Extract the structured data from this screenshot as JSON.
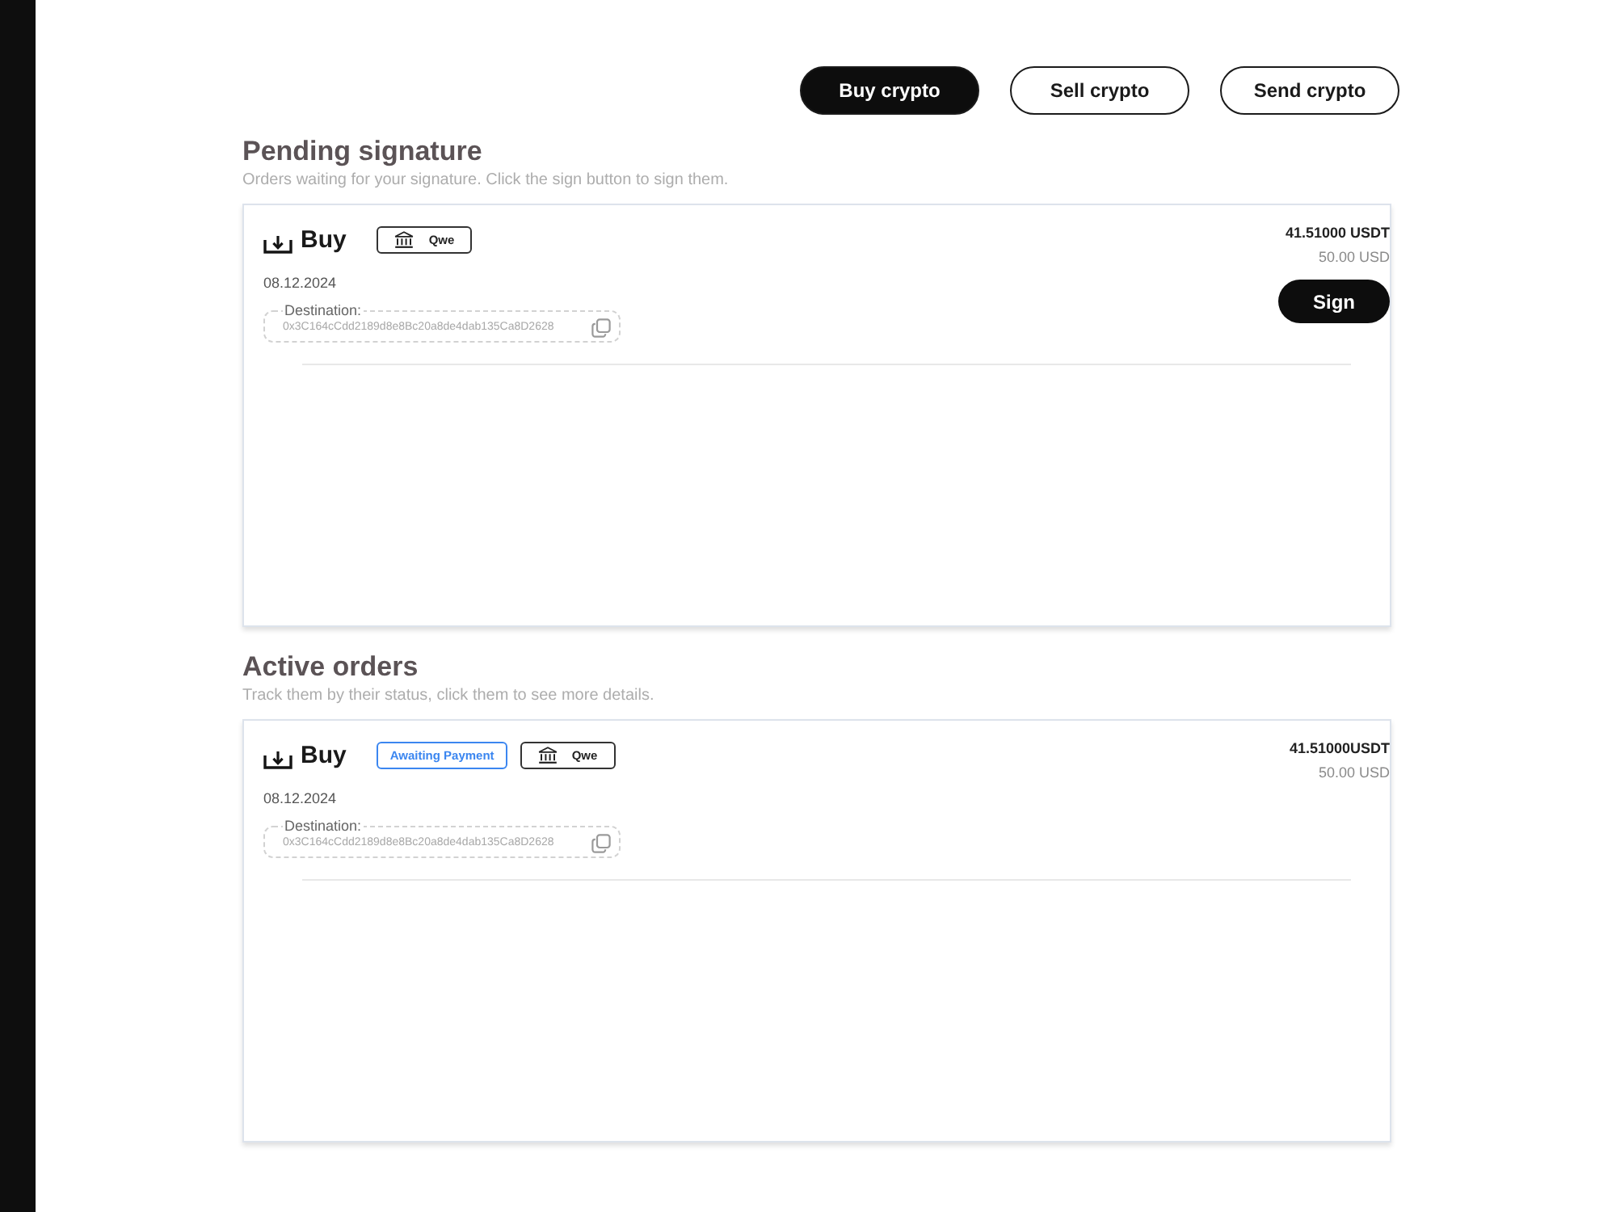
{
  "actions": [
    {
      "label": "Buy crypto",
      "selected": true
    },
    {
      "label": "Sell crypto",
      "selected": false
    },
    {
      "label": "Send crypto",
      "selected": false
    }
  ],
  "sections": [
    {
      "title": "Pending signature",
      "subtitle": "Orders waiting for your signature. Click the sign button to sign them.",
      "orders": [
        {
          "type": "Buy",
          "badges": [
            {
              "kind": "method",
              "label": "Qwe"
            }
          ],
          "date": "08.12.2024",
          "destination_label": "Destination:",
          "address": "0x3C164cCdd2189d8e8Bc20a8de4dab135Ca8D2628",
          "amount": "41.51000 USDT",
          "fiat": "50.00 USD",
          "action": "Sign"
        }
      ]
    },
    {
      "title": "Active orders",
      "subtitle": "Track them by their status, click them to see more details.",
      "orders": [
        {
          "type": "Buy",
          "badges": [
            {
              "kind": "status",
              "label": "Awaiting Payment"
            },
            {
              "kind": "method",
              "label": "Qwe"
            }
          ],
          "date": "08.12.2024",
          "destination_label": "Destination:",
          "address": "0x3C164cCdd2189d8e8Bc20a8de4dab135Ca8D2628",
          "amount": "41.51000USDT",
          "fiat": "50.00 USD"
        }
      ]
    }
  ]
}
